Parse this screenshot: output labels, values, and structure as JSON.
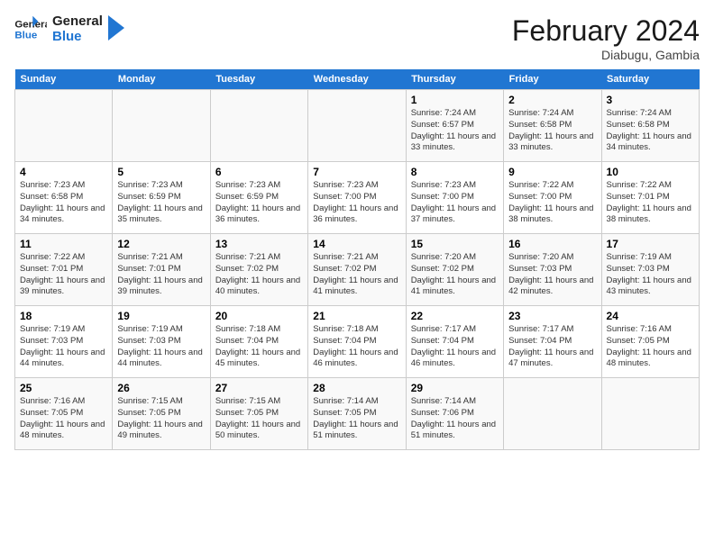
{
  "header": {
    "logo_general": "General",
    "logo_blue": "Blue",
    "month_year": "February 2024",
    "location": "Diabugu, Gambia"
  },
  "days_of_week": [
    "Sunday",
    "Monday",
    "Tuesday",
    "Wednesday",
    "Thursday",
    "Friday",
    "Saturday"
  ],
  "weeks": [
    [
      {
        "day": "",
        "info": ""
      },
      {
        "day": "",
        "info": ""
      },
      {
        "day": "",
        "info": ""
      },
      {
        "day": "",
        "info": ""
      },
      {
        "day": "1",
        "info": "Sunrise: 7:24 AM\nSunset: 6:57 PM\nDaylight: 11 hours and 33 minutes."
      },
      {
        "day": "2",
        "info": "Sunrise: 7:24 AM\nSunset: 6:58 PM\nDaylight: 11 hours and 33 minutes."
      },
      {
        "day": "3",
        "info": "Sunrise: 7:24 AM\nSunset: 6:58 PM\nDaylight: 11 hours and 34 minutes."
      }
    ],
    [
      {
        "day": "4",
        "info": "Sunrise: 7:23 AM\nSunset: 6:58 PM\nDaylight: 11 hours and 34 minutes."
      },
      {
        "day": "5",
        "info": "Sunrise: 7:23 AM\nSunset: 6:59 PM\nDaylight: 11 hours and 35 minutes."
      },
      {
        "day": "6",
        "info": "Sunrise: 7:23 AM\nSunset: 6:59 PM\nDaylight: 11 hours and 36 minutes."
      },
      {
        "day": "7",
        "info": "Sunrise: 7:23 AM\nSunset: 7:00 PM\nDaylight: 11 hours and 36 minutes."
      },
      {
        "day": "8",
        "info": "Sunrise: 7:23 AM\nSunset: 7:00 PM\nDaylight: 11 hours and 37 minutes."
      },
      {
        "day": "9",
        "info": "Sunrise: 7:22 AM\nSunset: 7:00 PM\nDaylight: 11 hours and 38 minutes."
      },
      {
        "day": "10",
        "info": "Sunrise: 7:22 AM\nSunset: 7:01 PM\nDaylight: 11 hours and 38 minutes."
      }
    ],
    [
      {
        "day": "11",
        "info": "Sunrise: 7:22 AM\nSunset: 7:01 PM\nDaylight: 11 hours and 39 minutes."
      },
      {
        "day": "12",
        "info": "Sunrise: 7:21 AM\nSunset: 7:01 PM\nDaylight: 11 hours and 39 minutes."
      },
      {
        "day": "13",
        "info": "Sunrise: 7:21 AM\nSunset: 7:02 PM\nDaylight: 11 hours and 40 minutes."
      },
      {
        "day": "14",
        "info": "Sunrise: 7:21 AM\nSunset: 7:02 PM\nDaylight: 11 hours and 41 minutes."
      },
      {
        "day": "15",
        "info": "Sunrise: 7:20 AM\nSunset: 7:02 PM\nDaylight: 11 hours and 41 minutes."
      },
      {
        "day": "16",
        "info": "Sunrise: 7:20 AM\nSunset: 7:03 PM\nDaylight: 11 hours and 42 minutes."
      },
      {
        "day": "17",
        "info": "Sunrise: 7:19 AM\nSunset: 7:03 PM\nDaylight: 11 hours and 43 minutes."
      }
    ],
    [
      {
        "day": "18",
        "info": "Sunrise: 7:19 AM\nSunset: 7:03 PM\nDaylight: 11 hours and 44 minutes."
      },
      {
        "day": "19",
        "info": "Sunrise: 7:19 AM\nSunset: 7:03 PM\nDaylight: 11 hours and 44 minutes."
      },
      {
        "day": "20",
        "info": "Sunrise: 7:18 AM\nSunset: 7:04 PM\nDaylight: 11 hours and 45 minutes."
      },
      {
        "day": "21",
        "info": "Sunrise: 7:18 AM\nSunset: 7:04 PM\nDaylight: 11 hours and 46 minutes."
      },
      {
        "day": "22",
        "info": "Sunrise: 7:17 AM\nSunset: 7:04 PM\nDaylight: 11 hours and 46 minutes."
      },
      {
        "day": "23",
        "info": "Sunrise: 7:17 AM\nSunset: 7:04 PM\nDaylight: 11 hours and 47 minutes."
      },
      {
        "day": "24",
        "info": "Sunrise: 7:16 AM\nSunset: 7:05 PM\nDaylight: 11 hours and 48 minutes."
      }
    ],
    [
      {
        "day": "25",
        "info": "Sunrise: 7:16 AM\nSunset: 7:05 PM\nDaylight: 11 hours and 48 minutes."
      },
      {
        "day": "26",
        "info": "Sunrise: 7:15 AM\nSunset: 7:05 PM\nDaylight: 11 hours and 49 minutes."
      },
      {
        "day": "27",
        "info": "Sunrise: 7:15 AM\nSunset: 7:05 PM\nDaylight: 11 hours and 50 minutes."
      },
      {
        "day": "28",
        "info": "Sunrise: 7:14 AM\nSunset: 7:05 PM\nDaylight: 11 hours and 51 minutes."
      },
      {
        "day": "29",
        "info": "Sunrise: 7:14 AM\nSunset: 7:06 PM\nDaylight: 11 hours and 51 minutes."
      },
      {
        "day": "",
        "info": ""
      },
      {
        "day": "",
        "info": ""
      }
    ]
  ]
}
